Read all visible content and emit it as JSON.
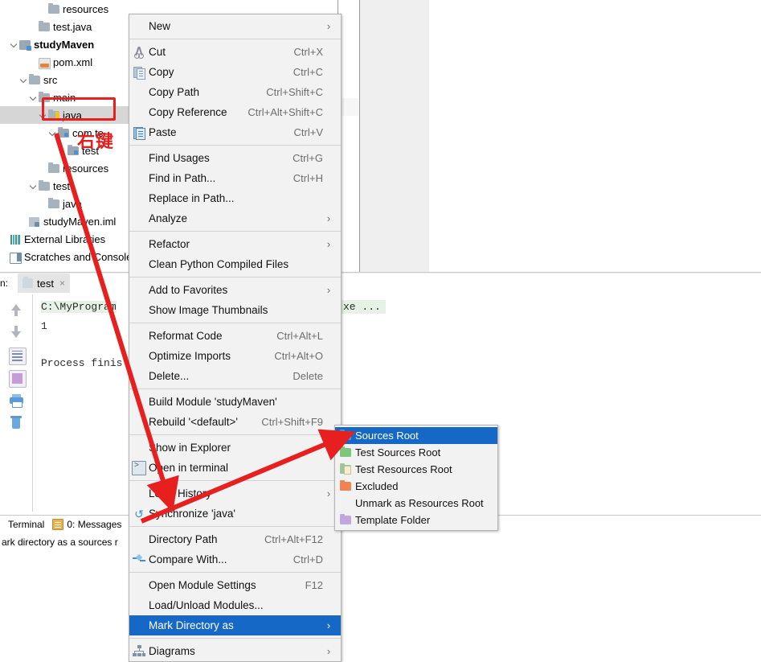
{
  "app": {
    "name": "IntelliJ IDEA",
    "accent_selection": "#1668c7",
    "annotation_red": "#e81f1f"
  },
  "project_tree": {
    "name": "project-tool-window",
    "items": [
      {
        "label": "resources",
        "icon": "folder-icon",
        "indent": 5,
        "twisty": false,
        "bold": false,
        "selected": false
      },
      {
        "label": "test.java",
        "icon": "folder-icon",
        "indent": 4,
        "twisty": false,
        "bold": false,
        "selected": false
      },
      {
        "label": "studyMaven",
        "icon": "module-icon",
        "indent": 2,
        "twisty": true,
        "bold": true,
        "selected": false
      },
      {
        "label": "pom.xml",
        "icon": "xml-file-icon",
        "indent": 4,
        "twisty": false,
        "bold": false,
        "selected": false
      },
      {
        "label": "src",
        "icon": "folder-icon",
        "indent": 3,
        "twisty": true,
        "bold": false,
        "selected": false
      },
      {
        "label": "main",
        "icon": "folder-icon",
        "indent": 4,
        "twisty": true,
        "bold": false,
        "selected": false
      },
      {
        "label": "java",
        "icon": "sources-folder-icon",
        "indent": 5,
        "twisty": true,
        "bold": false,
        "selected": true
      },
      {
        "label": "com.te",
        "icon": "package-icon",
        "indent": 6,
        "twisty": true,
        "bold": false,
        "selected": false
      },
      {
        "label": "test",
        "icon": "java-class-icon",
        "indent": 7,
        "twisty": false,
        "bold": false,
        "selected": false
      },
      {
        "label": "resources",
        "icon": "folder-icon",
        "indent": 5,
        "twisty": false,
        "bold": false,
        "selected": false
      },
      {
        "label": "test",
        "icon": "folder-icon",
        "indent": 4,
        "twisty": true,
        "bold": false,
        "selected": false
      },
      {
        "label": "java",
        "icon": "folder-icon",
        "indent": 5,
        "twisty": false,
        "bold": false,
        "selected": false
      },
      {
        "label": "studyMaven.iml",
        "icon": "iml-file-icon",
        "indent": 3,
        "twisty": false,
        "bold": false,
        "selected": false
      },
      {
        "label": "External Libraries",
        "icon": "libraries-icon",
        "indent": 1,
        "twisty": false,
        "bold": false,
        "selected": false
      },
      {
        "label": "Scratches and Consoles",
        "icon": "scratches-icon",
        "indent": 1,
        "twisty": false,
        "bold": false,
        "selected": false
      }
    ]
  },
  "context_menu": {
    "name": "file-context-menu",
    "items": [
      {
        "label": "New",
        "accel": "",
        "icon": "",
        "arrow": true,
        "sep_after": true,
        "highlight": false
      },
      {
        "label": "Cut",
        "accel": "Ctrl+X",
        "icon": "cut-icon",
        "arrow": false,
        "sep_after": false,
        "highlight": false
      },
      {
        "label": "Copy",
        "accel": "Ctrl+C",
        "icon": "copy-icon",
        "arrow": false,
        "sep_after": false,
        "highlight": false
      },
      {
        "label": "Copy Path",
        "accel": "Ctrl+Shift+C",
        "icon": "",
        "arrow": false,
        "sep_after": false,
        "highlight": false
      },
      {
        "label": "Copy Reference",
        "accel": "Ctrl+Alt+Shift+C",
        "icon": "",
        "arrow": false,
        "sep_after": false,
        "highlight": false
      },
      {
        "label": "Paste",
        "accel": "Ctrl+V",
        "icon": "paste-icon",
        "arrow": false,
        "sep_after": true,
        "highlight": false
      },
      {
        "label": "Find Usages",
        "accel": "Ctrl+G",
        "icon": "",
        "arrow": false,
        "sep_after": false,
        "highlight": false
      },
      {
        "label": "Find in Path...",
        "accel": "Ctrl+H",
        "icon": "",
        "arrow": false,
        "sep_after": false,
        "highlight": false
      },
      {
        "label": "Replace in Path...",
        "accel": "",
        "icon": "",
        "arrow": false,
        "sep_after": false,
        "highlight": false
      },
      {
        "label": "Analyze",
        "accel": "",
        "icon": "",
        "arrow": true,
        "sep_after": true,
        "highlight": false
      },
      {
        "label": "Refactor",
        "accel": "",
        "icon": "",
        "arrow": true,
        "sep_after": false,
        "highlight": false
      },
      {
        "label": "Clean Python Compiled Files",
        "accel": "",
        "icon": "",
        "arrow": false,
        "sep_after": true,
        "highlight": false
      },
      {
        "label": "Add to Favorites",
        "accel": "",
        "icon": "",
        "arrow": true,
        "sep_after": false,
        "highlight": false
      },
      {
        "label": "Show Image Thumbnails",
        "accel": "",
        "icon": "",
        "arrow": false,
        "sep_after": true,
        "highlight": false
      },
      {
        "label": "Reformat Code",
        "accel": "Ctrl+Alt+L",
        "icon": "",
        "arrow": false,
        "sep_after": false,
        "highlight": false
      },
      {
        "label": "Optimize Imports",
        "accel": "Ctrl+Alt+O",
        "icon": "",
        "arrow": false,
        "sep_after": false,
        "highlight": false
      },
      {
        "label": "Delete...",
        "accel": "Delete",
        "icon": "",
        "arrow": false,
        "sep_after": true,
        "highlight": false
      },
      {
        "label": "Build Module 'studyMaven'",
        "accel": "",
        "icon": "",
        "arrow": false,
        "sep_after": false,
        "highlight": false
      },
      {
        "label": "Rebuild '<default>'",
        "accel": "Ctrl+Shift+F9",
        "icon": "",
        "arrow": false,
        "sep_after": true,
        "highlight": false
      },
      {
        "label": "Show in Explorer",
        "accel": "",
        "icon": "",
        "arrow": false,
        "sep_after": false,
        "highlight": false
      },
      {
        "label": "Open in terminal",
        "accel": "",
        "icon": "terminal-icon",
        "arrow": false,
        "sep_after": true,
        "highlight": false
      },
      {
        "label": "Local History",
        "accel": "",
        "icon": "",
        "arrow": true,
        "sep_after": false,
        "highlight": false
      },
      {
        "label": "Synchronize 'java'",
        "accel": "",
        "icon": "sync-icon",
        "arrow": false,
        "sep_after": true,
        "highlight": false
      },
      {
        "label": "Directory Path",
        "accel": "Ctrl+Alt+F12",
        "icon": "",
        "arrow": false,
        "sep_after": false,
        "highlight": false
      },
      {
        "label": "Compare With...",
        "accel": "Ctrl+D",
        "icon": "compare-icon",
        "arrow": false,
        "sep_after": true,
        "highlight": false
      },
      {
        "label": "Open Module Settings",
        "accel": "F12",
        "icon": "",
        "arrow": false,
        "sep_after": false,
        "highlight": false
      },
      {
        "label": "Load/Unload Modules...",
        "accel": "",
        "icon": "",
        "arrow": false,
        "sep_after": false,
        "highlight": false
      },
      {
        "label": "Mark Directory as",
        "accel": "",
        "icon": "",
        "arrow": true,
        "sep_after": true,
        "highlight": true
      },
      {
        "label": "Diagrams",
        "accel": "",
        "icon": "diagram-icon",
        "arrow": true,
        "sep_after": false,
        "highlight": false
      }
    ]
  },
  "submenu": {
    "name": "mark-directory-as-submenu",
    "items": [
      {
        "label": "Sources Root",
        "icon": "sources-root-folder-icon",
        "highlight": true
      },
      {
        "label": "Test Sources Root",
        "icon": "test-sources-root-folder-icon",
        "highlight": false
      },
      {
        "label": "Test Resources Root",
        "icon": "test-resources-root-folder-icon",
        "highlight": false
      },
      {
        "label": "Excluded",
        "icon": "excluded-folder-icon",
        "highlight": false
      },
      {
        "label": "Unmark as Resources Root",
        "icon": "",
        "highlight": false
      },
      {
        "label": "Template Folder",
        "icon": "template-folder-icon",
        "highlight": false
      }
    ]
  },
  "run_panel": {
    "name": "run-tool-window",
    "run_label": "n:",
    "tab_label": "test",
    "close_glyph": "×",
    "console_lines": [
      {
        "text": "C:\\MyProgram",
        "highlight": true
      },
      {
        "text": "1",
        "highlight": false
      },
      {
        "text": "Process finis",
        "highlight": false
      }
    ],
    "editor_fragment": "xe ...",
    "toolbar_icons": [
      "arrow-up-icon",
      "arrow-down-icon",
      "soft-wrap-icon",
      "export-icon",
      "print-icon",
      "trash-icon"
    ]
  },
  "bottom_bar": {
    "name": "tool-window-bar",
    "terminal_label": "Terminal",
    "messages_label": "0: Messages"
  },
  "status_bar": {
    "name": "status-bar",
    "text": "ark directory as a sources r"
  },
  "annotations": {
    "right_click_note": "右键",
    "highlight_box_target": "java"
  }
}
